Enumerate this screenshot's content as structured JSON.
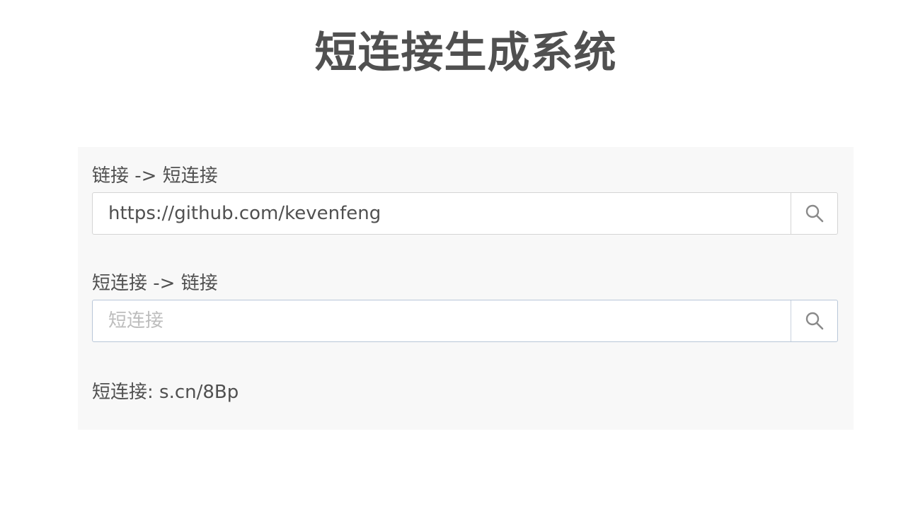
{
  "title": "短连接生成系统",
  "encode": {
    "label": "链接 -> 短连接",
    "value": "https://github.com/kevenfeng",
    "placeholder": "",
    "button_icon": "search-icon"
  },
  "decode": {
    "label": "短连接 -> 链接",
    "value": "",
    "placeholder": "短连接",
    "button_icon": "search-icon"
  },
  "result": {
    "text": "短连接: s.cn/8Bp"
  },
  "colors": {
    "text": "#505050",
    "panel_background": "#f8f8f8",
    "border": "#d4d4d4",
    "placeholder": "#bdbdbd",
    "icon": "#8a8a8a"
  }
}
